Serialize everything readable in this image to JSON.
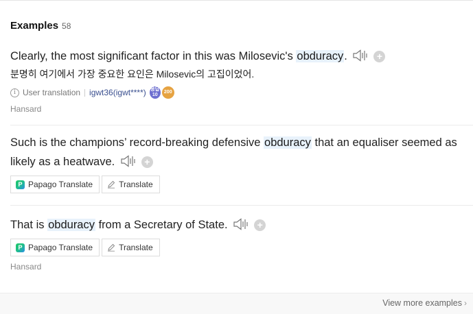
{
  "header": {
    "title": "Examples",
    "count": "58"
  },
  "examples": [
    {
      "pre": "Clearly, the most significant factor in this was Milosevic's ",
      "hl": "obduracy",
      "post": ".",
      "korean": "분명히 여기에서 가장 중요한 요인은 Milosevic의 고집이었어.",
      "user_translation_label": "User translation",
      "user_id": "igwt36(igwt****)",
      "badge1": "응답\n10",
      "badge2": "200",
      "source": "Hansard"
    },
    {
      "line1_pre": "Such is the champions’ record-breaking defensive ",
      "hl": "obduracy",
      "line1_post": " that an equaliser seemed as",
      "line2": "likely as a heatwave.",
      "papago_label": "Papago Translate",
      "translate_label": "Translate"
    },
    {
      "pre": "That is ",
      "hl": "obduracy",
      "post": " from a Secretary of State.",
      "papago_label": "Papago Translate",
      "translate_label": "Translate",
      "source": "Hansard"
    }
  ],
  "footer": {
    "more_label": "View more examples"
  },
  "colors": {
    "highlight": "#e8f2fb",
    "papago": "#1fc76a",
    "link": "#3a4f8f"
  }
}
